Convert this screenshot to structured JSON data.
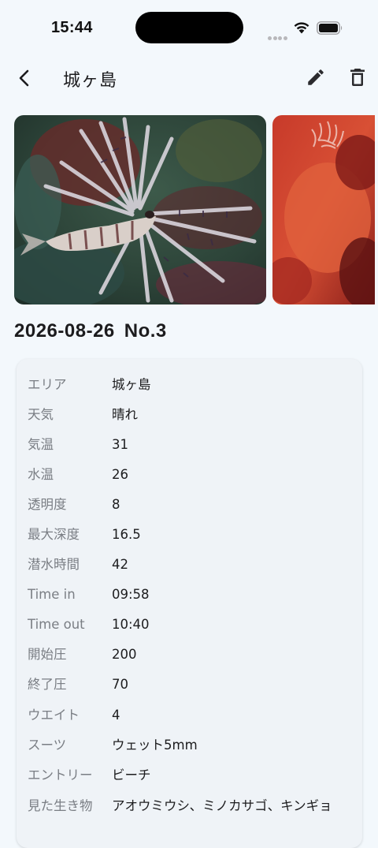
{
  "status_bar": {
    "time": "15:44"
  },
  "header": {
    "title": "城ヶ島"
  },
  "photos": [
    {
      "alt": "ミノカサゴ"
    },
    {
      "alt": "サンゴ"
    }
  ],
  "dive": {
    "date": "2026-08-26",
    "number": "No.3"
  },
  "details": [
    {
      "label": "エリア",
      "value": "城ヶ島"
    },
    {
      "label": "天気",
      "value": "晴れ"
    },
    {
      "label": "気温",
      "value": "31"
    },
    {
      "label": "水温",
      "value": "26"
    },
    {
      "label": "透明度",
      "value": "8"
    },
    {
      "label": "最大深度",
      "value": "16.5"
    },
    {
      "label": "潜水時間",
      "value": "42"
    },
    {
      "label": "Time in",
      "value": "09:58"
    },
    {
      "label": "Time out",
      "value": "10:40"
    },
    {
      "label": "開始圧",
      "value": "200"
    },
    {
      "label": "終了圧",
      "value": "70"
    },
    {
      "label": "ウエイト",
      "value": "4"
    },
    {
      "label": "スーツ",
      "value": "ウェット5mm"
    },
    {
      "label": "エントリー",
      "value": "ビーチ"
    },
    {
      "label": "見た生き物",
      "value": "アオウミウシ、ミノカサゴ、キンギョ"
    }
  ]
}
